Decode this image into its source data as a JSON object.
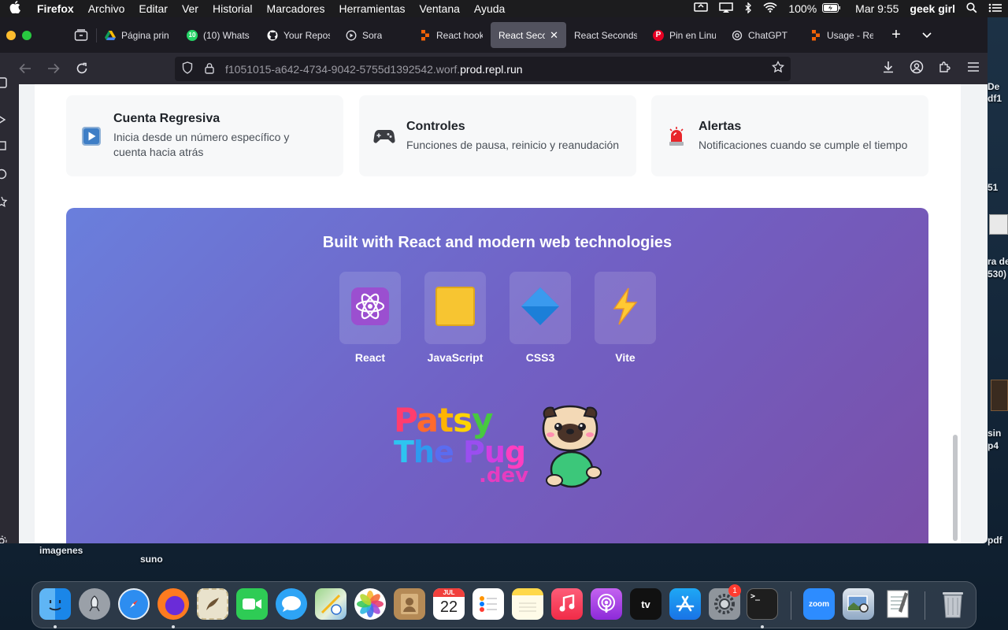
{
  "menubar": {
    "app": "Firefox",
    "items": [
      "Archivo",
      "Editar",
      "Ver",
      "Historial",
      "Marcadores",
      "Herramientas",
      "Ventana",
      "Ayuda"
    ],
    "battery": "100%",
    "clock": "Mar 9:55",
    "user": "geek girl"
  },
  "tabs": [
    {
      "label": "Página prin",
      "icon": "google-drive-icon"
    },
    {
      "label": "(10) Whats",
      "icon": "whatsapp-icon"
    },
    {
      "label": "Your Repos",
      "icon": "github-icon"
    },
    {
      "label": "Sora",
      "icon": "sora-icon"
    },
    {
      "label": "React hook",
      "icon": "replit-icon"
    },
    {
      "label": "React Secon",
      "icon": "none",
      "active": true
    },
    {
      "label": "React Seconds",
      "icon": "none"
    },
    {
      "label": "Pin en Linu",
      "icon": "pinterest-icon"
    },
    {
      "label": "ChatGPT",
      "icon": "openai-icon"
    },
    {
      "label": "Usage - Re",
      "icon": "replit-icon"
    }
  ],
  "url": {
    "prefix": "f1051015-a642-4734-9042-5755d1392542.worf.",
    "domain": "prod.repl.run"
  },
  "features": [
    {
      "title": "Cuenta Regresiva",
      "desc": "Inicia desde un número específico y cuenta hacia atrás",
      "icon": "play-button-icon"
    },
    {
      "title": "Controles",
      "desc": "Funciones de pausa, reinicio y reanudación",
      "icon": "gamepad-icon"
    },
    {
      "title": "Alertas",
      "desc": "Notificaciones cuando se cumple el tiempo",
      "icon": "siren-icon"
    }
  ],
  "tech": {
    "heading": "Built with React and modern web technologies",
    "items": [
      {
        "label": "React",
        "icon": "atom-icon"
      },
      {
        "label": "JavaScript",
        "icon": "yellow-square-icon"
      },
      {
        "label": "CSS3",
        "icon": "blue-diamond-icon"
      },
      {
        "label": "Vite",
        "icon": "lightning-icon"
      }
    ]
  },
  "logo": {
    "line1": "Patsy",
    "line2": "The Pug",
    "line3": ".dev"
  },
  "desktop": {
    "folders": [
      "imagenes",
      "suno"
    ],
    "side_peek": [
      "De",
      "df1",
      "51",
      "ra de",
      "530)",
      "sin",
      "p4",
      "pdf"
    ]
  },
  "dock": {
    "apps": [
      "Finder",
      "Launchpad",
      "Safari",
      "Firefox",
      "Mail",
      "FaceTime",
      "Messages",
      "Maps",
      "Photos",
      "Contacts",
      "Calendar",
      "Reminders",
      "Notes",
      "Music",
      "Podcasts",
      "TV",
      "App Store",
      "System Preferences",
      "Terminal",
      "zoom",
      "Preview",
      "TextEdit",
      "Trash"
    ],
    "calendar_month": "JUL",
    "calendar_day": "22",
    "tv_label": "tv",
    "zoom_label": "zoom",
    "settings_badge": "1"
  }
}
